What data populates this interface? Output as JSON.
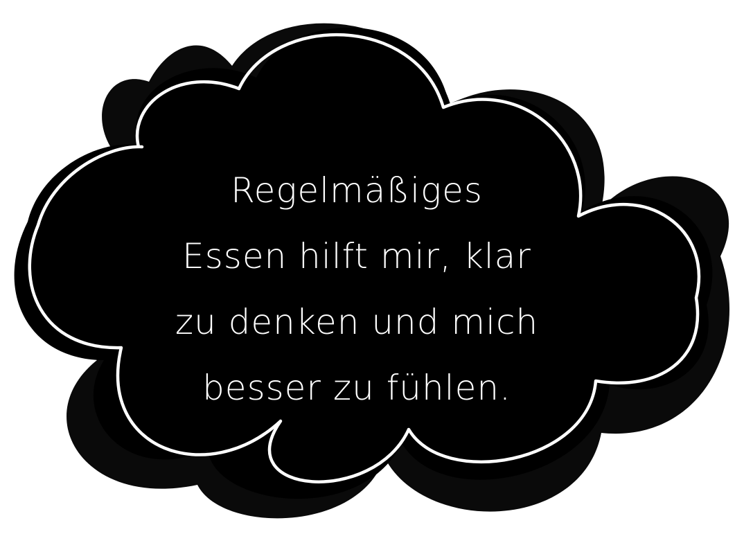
{
  "cloud": {
    "fill_color": "#000000",
    "outline_color": "#ffffff",
    "shadow_color": "#0a0a0a",
    "background_color": "#ffffff"
  },
  "message": {
    "lines": [
      "Regelmäßiges",
      "Essen hilft mir, klar",
      "zu denken und mich",
      "besser zu fühlen."
    ]
  }
}
